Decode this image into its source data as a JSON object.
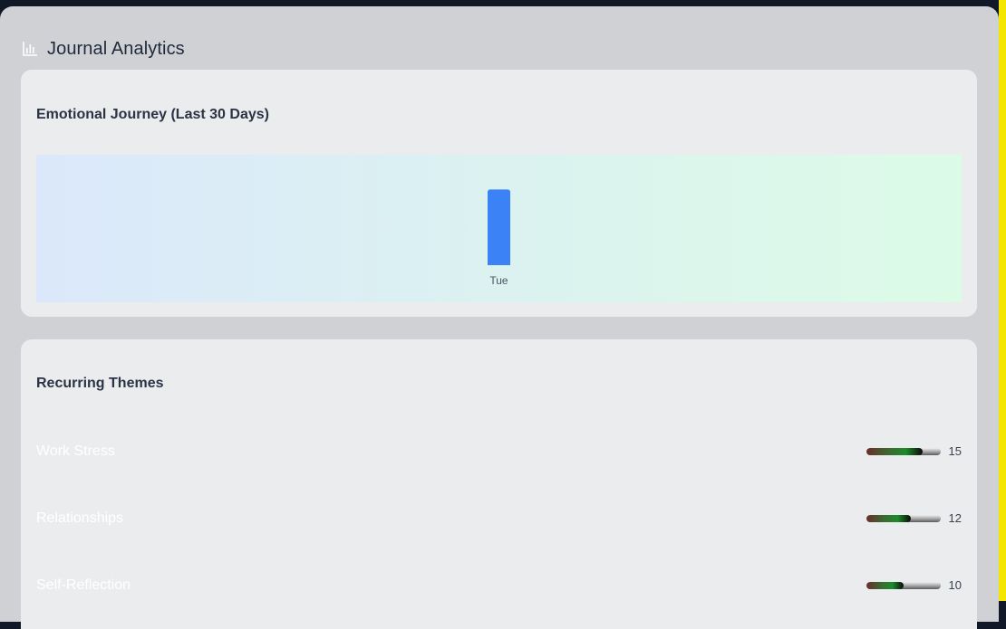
{
  "header": {
    "title": "Journal Analytics",
    "icon": "bar-chart-icon"
  },
  "emotional_journey": {
    "title": "Emotional Journey (Last 30 Days)"
  },
  "chart_data": {
    "type": "bar",
    "categories": [
      "Tue"
    ],
    "values": [
      1
    ],
    "ylim": [
      0,
      1.4
    ],
    "title": "Emotional Journey (Last 30 Days)",
    "xlabel": "",
    "ylabel": "",
    "colors": {
      "bar": "#3b82f6"
    }
  },
  "themes": {
    "title": "Recurring Themes",
    "max_count": 20,
    "items": [
      {
        "label": "Work Stress",
        "count": "15",
        "value": 15
      },
      {
        "label": "Relationships",
        "count": "12",
        "value": 12
      },
      {
        "label": "Self-Reflection",
        "count": "10",
        "value": 10
      }
    ]
  }
}
